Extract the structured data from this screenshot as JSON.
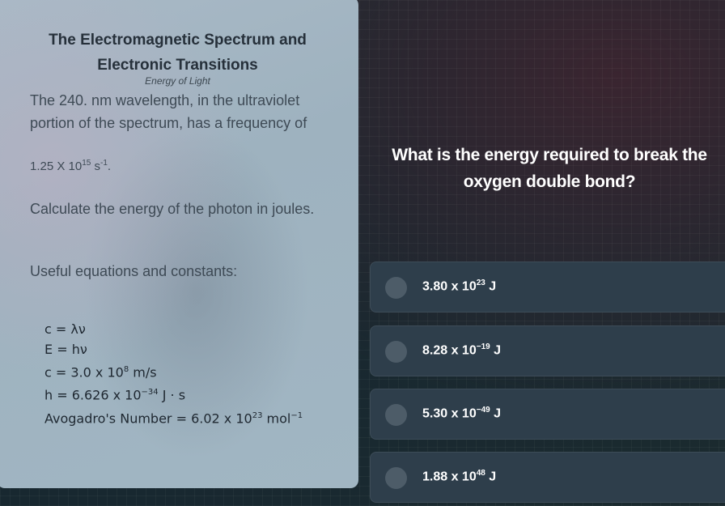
{
  "info_card": {
    "title_line1": "The Electromagnetic Spectrum and",
    "title_line2": "Electronic Transitions",
    "subtitle": "Energy of Light",
    "paragraph1": "The 240. nm wavelength, in the ultraviolet portion of the spectrum, has a frequency of",
    "frequency_value": "1.25 X 10",
    "frequency_exp": "15",
    "frequency_unit": " s",
    "frequency_unit_exp": "-1",
    "frequency_end": ".",
    "paragraph2": "Calculate the energy of the photon in joules.",
    "paragraph3": "Useful equations and constants:",
    "equations": {
      "eq1": "c = λν",
      "eq2": "E = hν",
      "eq3_base": "c = 3.0 x 10",
      "eq3_exp": "8",
      "eq3_unit": " m/s",
      "eq4_base": "h = 6.626 x 10",
      "eq4_exp": "−34",
      "eq4_unit": " J · s",
      "eq5_base": "Avogadro's Number = 6.02 x 10",
      "eq5_exp": "23",
      "eq5_unit": " mol",
      "eq5_unit_exp": "−1"
    }
  },
  "question": {
    "text": "What is the energy required to break the oxygen double bond?"
  },
  "options": [
    {
      "base": "3.80 x 10",
      "exp": "23",
      "unit": " J"
    },
    {
      "base": "8.28 x 10",
      "exp": "−19",
      "unit": " J"
    },
    {
      "base": "5.30 x 10",
      "exp": "−49",
      "unit": " J"
    },
    {
      "base": "1.88 x 10",
      "exp": "48",
      "unit": " J"
    }
  ],
  "colors": {
    "option_bg": "#2e3e4b",
    "radio": "#4d5c68",
    "card_bg": "#a1b6c3"
  }
}
